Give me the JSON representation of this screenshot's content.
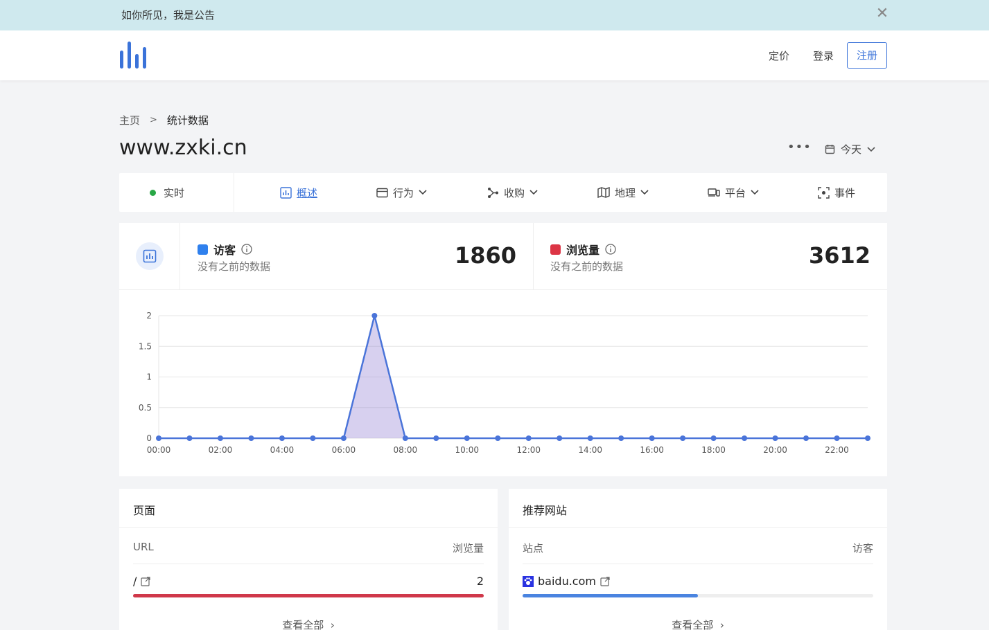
{
  "announcement": {
    "text": "如你所见，我是公告"
  },
  "nav": {
    "pricing": "定价",
    "login": "登录",
    "signup": "注册"
  },
  "breadcrumb": {
    "home": "主页",
    "current": "统计数据"
  },
  "site": {
    "title": "www.zxki.cn"
  },
  "date_range": {
    "label": "今天"
  },
  "tabs": [
    {
      "label": "实时",
      "icon": "live-dot-icon"
    },
    {
      "label": "概述",
      "icon": "bar-chart-icon"
    },
    {
      "label": "行为",
      "icon": "window-icon"
    },
    {
      "label": "收购",
      "icon": "share-nodes-icon"
    },
    {
      "label": "地理",
      "icon": "map-icon"
    },
    {
      "label": "平台",
      "icon": "devices-icon"
    },
    {
      "label": "事件",
      "icon": "scan-icon"
    }
  ],
  "metrics": {
    "visitors": {
      "name": "访客",
      "sub": "没有之前的数据",
      "value": "1860",
      "color": "#2f80ed"
    },
    "pageviews": {
      "name": "浏览量",
      "sub": "没有之前的数据",
      "value": "3612",
      "color": "#dc3545"
    }
  },
  "chart_data": {
    "type": "area",
    "x": [
      "00:00",
      "01:00",
      "02:00",
      "03:00",
      "04:00",
      "05:00",
      "06:00",
      "07:00",
      "08:00",
      "09:00",
      "10:00",
      "11:00",
      "12:00",
      "13:00",
      "14:00",
      "15:00",
      "16:00",
      "17:00",
      "18:00",
      "19:00",
      "20:00",
      "21:00",
      "22:00",
      "23:00"
    ],
    "tick_labels": [
      "00:00",
      "02:00",
      "04:00",
      "06:00",
      "08:00",
      "10:00",
      "12:00",
      "14:00",
      "16:00",
      "18:00",
      "20:00",
      "22:00"
    ],
    "series": [
      {
        "values": [
          0,
          0,
          0,
          0,
          0,
          0,
          0,
          2,
          0,
          0,
          0,
          0,
          0,
          0,
          0,
          0,
          0,
          0,
          0,
          0,
          0,
          0,
          0,
          0
        ],
        "color": "#4a74d9"
      }
    ],
    "y_ticks": [
      "0",
      "0.5",
      "1",
      "1.5",
      "2"
    ],
    "ylim": [
      0,
      2
    ],
    "grid": true
  },
  "pages_panel": {
    "title": "页面",
    "col_left": "URL",
    "col_right": "浏览量",
    "row": {
      "label": "/",
      "value": "2",
      "fraction": 1.0
    },
    "view_all": "查看全部"
  },
  "referrers_panel": {
    "title": "推荐网站",
    "col_left": "站点",
    "col_right": "访客",
    "row": {
      "label": "baidu.com",
      "fraction": 0.5
    },
    "view_all": "查看全部"
  }
}
